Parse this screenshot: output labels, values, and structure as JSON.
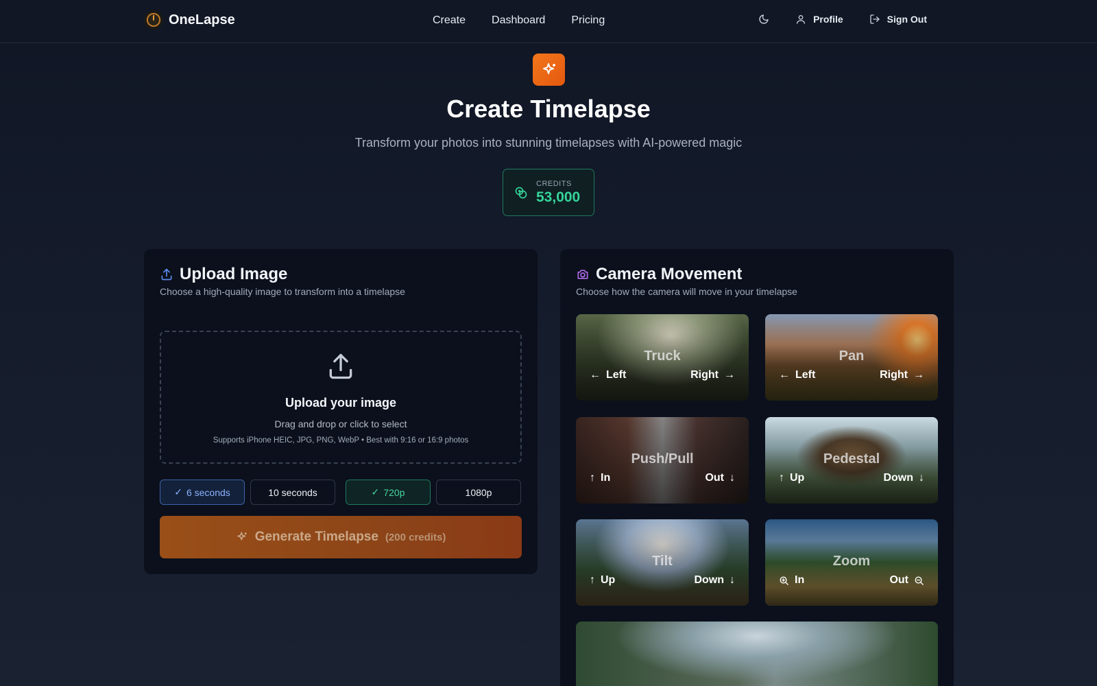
{
  "app": {
    "name": "OneLapse"
  },
  "nav": {
    "links": [
      "Create",
      "Dashboard",
      "Pricing"
    ],
    "profile": "Profile",
    "signout": "Sign Out"
  },
  "hero": {
    "title": "Create Timelapse",
    "subtitle": "Transform your photos into stunning timelapses with AI-powered magic"
  },
  "credits": {
    "label": "CREDITS",
    "value": "53,000"
  },
  "upload": {
    "title": "Upload Image",
    "desc": "Choose a high-quality image to transform into a timelapse",
    "dz_title": "Upload your image",
    "dz_sub": "Drag and drop or click to select",
    "dz_note": "Supports iPhone HEIC, JPG, PNG, WebP • Best with 9:16 or 16:9 photos",
    "durations": [
      {
        "label": "6 seconds",
        "selected": true
      },
      {
        "label": "10 seconds",
        "selected": false
      }
    ],
    "resolutions": [
      {
        "label": "720p",
        "selected": true
      },
      {
        "label": "1080p",
        "selected": false
      }
    ],
    "generate_label": "Generate Timelapse",
    "generate_cost": "(200 credits)"
  },
  "camera": {
    "title": "Camera Movement",
    "desc": "Choose how the camera will move in your timelapse",
    "tiles": [
      {
        "name": "Truck",
        "left": "Left",
        "right": "Right"
      },
      {
        "name": "Pan",
        "left": "Left",
        "right": "Right"
      },
      {
        "name": "Push/Pull",
        "left": "In",
        "right": "Out"
      },
      {
        "name": "Pedestal",
        "left": "Up",
        "right": "Down"
      },
      {
        "name": "Tilt",
        "left": "Up",
        "right": "Down"
      },
      {
        "name": "Zoom",
        "left": "In",
        "right": "Out"
      }
    ]
  },
  "colors": {
    "accent_orange": "#f2761b",
    "credits_green": "#35d49a",
    "selected_blue": "#8cb2ff"
  }
}
